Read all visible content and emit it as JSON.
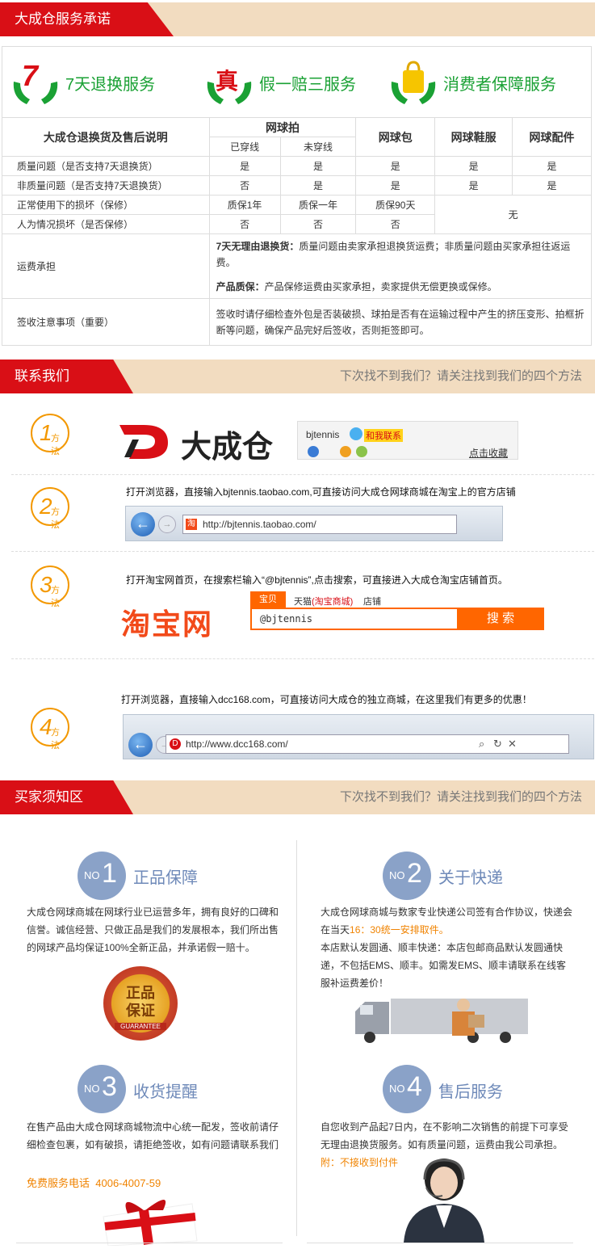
{
  "section1": {
    "title": "大成仓服务承诺"
  },
  "services": [
    {
      "label": "7天退换服务",
      "icon": "seven-day-return-icon",
      "badge": "7"
    },
    {
      "label": "假一赔三服务",
      "icon": "genuine-guarantee-icon",
      "badge": "真"
    },
    {
      "label": "消费者保障服务",
      "icon": "consumer-protection-icon",
      "badge": ""
    }
  ],
  "table": {
    "corner": "大成仓退换货及售后说明",
    "racket": "网球拍",
    "worn": "已穿线",
    "unworn": "未穿线",
    "bag": "网球包",
    "shoes": "网球鞋服",
    "acc": "网球配件",
    "rows": [
      {
        "label": "质量问题（是否支持7天退换货）",
        "c": [
          "是",
          "是",
          "是",
          "是",
          "是"
        ]
      },
      {
        "label": "非质量问题（是否支持7天退换货）",
        "c": [
          "否",
          "是",
          "是",
          "是",
          "是"
        ]
      },
      {
        "label": "正常使用下的损坏（保修）",
        "c": [
          "质保1年",
          "质保一年",
          "质保90天"
        ]
      },
      {
        "label": "人为情况损坏（是否保修）",
        "c": [
          "否",
          "否",
          "否"
        ]
      }
    ],
    "none": "无",
    "ship_label": "运费承担",
    "ship1_b": "7天无理由退换货：",
    "ship1": "质量问题由卖家承担退换货运费；非质量问题由买家承担往返运费。",
    "ship2_b": "产品质保：",
    "ship2": "产品保修运费由买家承担，卖家提供无偿更换或保修。",
    "sign_label": "签收注意事项（重要）",
    "sign": "签收时请仔细检查外包是否装破损、球拍是否有在运输过程中产生的挤压变形、拍框折断等问题，确保产品完好后签收，否则拒签即可。"
  },
  "section2": {
    "title": "联系我们",
    "sub": "下次找不到我们？请关注找到我们的四个方法"
  },
  "methods": {
    "suffix": "方法",
    "m1": {
      "n": "1",
      "brand": "大成仓",
      "user": "bjtennis",
      "contact": "和我联系",
      "fav": "点击收藏"
    },
    "m2": {
      "n": "2",
      "text": "打开浏览器，直接输入bjtennis.taobao.com,可直接访问大成仓网球商城在淘宝上的官方店铺",
      "url": "http://bjtennis.taobao.com/",
      "fav": "淘"
    },
    "m3": {
      "n": "3",
      "text": "打开淘宝网首页，在搜索栏输入“@bjtennis”,点击搜索，可直接进入大成仓淘宝店铺首页。",
      "logo": "淘宝网",
      "tab1": "宝贝",
      "tab2a": "天猫",
      "tab2b": "(淘宝商城)",
      "tab3": "店铺",
      "query": "@bjtennis",
      "btn": "搜 索"
    },
    "m4": {
      "n": "4",
      "text": "打开浏览器，直接输入dcc168.com，可直接访问大成仓的独立商城，在这里我们有更多的优惠！",
      "url": "http://www.dcc168.com/",
      "fav": "D"
    }
  },
  "section3": {
    "title": "买家须知区",
    "sub": "下次找不到我们？请关注找到我们的四个方法"
  },
  "no": "NO",
  "buyer": [
    {
      "n": "1",
      "title": "正品保障",
      "text": "大成仓网球商城在网球行业已运营多年，拥有良好的口碑和信誉。诚信经营、只做正品是我们的发展根本，我们所出售的网球产品均保证100%全新正品，并承诺假一赔十。",
      "seal1": "正品",
      "seal2": "保证",
      "seal3": "GUARANTEE"
    },
    {
      "n": "2",
      "title": "关于快递",
      "t1": "大成仓网球商城与数家专业快递公司签有合作协议，快递会在当天",
      "t1o": "16：30统一安排取件。",
      "t2": "本店默认发圆通、顺丰快递：本店包邮商品默认发圆通快递，不包括EMS、顺丰。如需发EMS、顺丰请联系在线客服补运费差价！"
    },
    {
      "n": "3",
      "title": "收货提醒",
      "text": "在售产品由大成仓网球商城物流中心统一配发，签收前请仔细检查包裹，如有破损，请拒绝签收，如有问题请联系我们",
      "phone_l": "免费服务电话",
      "phone": "4006-4007-59"
    },
    {
      "n": "4",
      "title": "售后服务",
      "text": "自您收到产品起7日内，在不影响二次销售的前提下可享受无理由退换货服务。如有质量问题，运费由我公司承担。",
      "note": "附：不接收到付件"
    }
  ],
  "colors": {
    "brand_red": "#d90f16",
    "accent_orange": "#f39800",
    "green": "#1aa134",
    "slate": "#8aa2c8"
  }
}
